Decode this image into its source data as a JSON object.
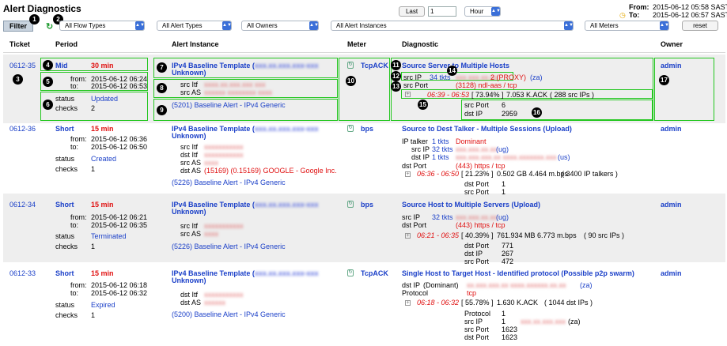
{
  "app": {
    "title": "Alert Diagnostics",
    "filter_tab": "Filter",
    "refresh_icon": "refresh-icon"
  },
  "time_range": {
    "last_label": "Last",
    "count": "1",
    "unit": "Hour",
    "from_label": "From:",
    "from_value": "2015-06-12 05:58 SAST",
    "to_label": "To:",
    "to_value": "2015-06-12 06:57 SAST"
  },
  "filters": {
    "flow_types": "All Flow Types",
    "alert_types": "All Alert Types",
    "owners": "All Owners",
    "instances": "All Alert Instances",
    "meters": "All Meters",
    "reset": "reset"
  },
  "columns": {
    "ticket": "Ticket",
    "period": "Period",
    "instance": "Alert Instance",
    "meter": "Meter",
    "diagnostic": "Diagnostic",
    "owner": "Owner"
  },
  "badges": [
    "1",
    "2",
    "3",
    "4",
    "5",
    "6",
    "7",
    "8",
    "9",
    "10",
    "11",
    "12",
    "13",
    "14",
    "15",
    "16",
    "17"
  ],
  "colors": {
    "highlight": "#22c61e",
    "link": "#1a3fc8",
    "alert": "#e01010",
    "row_alt": "#eeeeee"
  },
  "rows": [
    {
      "ticket": "0612-35",
      "severity": "Mid",
      "duration": "30 min",
      "from_label": "from:",
      "from": "2015-06-12 06:24",
      "to_label": "to:",
      "to": "2015-06-12 06:53",
      "status_label": "status",
      "status": "Updated",
      "checks_label": "checks",
      "checks": "2",
      "instance_title": "IPv4 Baseline Template (",
      "instance_blur": "xxx.xx.xxx.xxx-xxx",
      "instance_tail": "Unknown)",
      "instance_fields": [
        {
          "label": "src Itf",
          "value": "xxxx.xx.xxx.xxx xxx"
        },
        {
          "label": "src AS",
          "value": "xxxxxx xxxxxxxx xxxx"
        }
      ],
      "alert_link": "(5201)  Baseline Alert - IPv4 Generic",
      "meter": "TcpACK",
      "diag_title": "Source Server to Multiple Hosts",
      "diag_lines": [
        {
          "label": "src IP",
          "tkts": "34 tkts",
          "blur": "xxx.xxx.xx.xx",
          "extra": "2 (PROXY)",
          "tag": "(za)"
        },
        {
          "label": "src Port",
          "extra": "(3128) ndl-aas / tcp"
        }
      ],
      "time_window": "06:39 - 06:53",
      "pct": "[ 73.94% ]",
      "rate": "7.053 K.ACK",
      "peers": "( 288 src IPs )",
      "details": [
        {
          "label": "src Port",
          "value": "6"
        },
        {
          "label": "dst IP",
          "value": "2959"
        }
      ],
      "owner": "admin"
    },
    {
      "ticket": "0612-36",
      "severity": "Short",
      "duration": "15 min",
      "from_label": "from:",
      "from": "2015-06-12 06:36",
      "to_label": "to:",
      "to": "2015-06-12 06:50",
      "status_label": "status",
      "status": "Created",
      "checks_label": "checks",
      "checks": "1",
      "instance_title": "IPv4 Baseline Template (",
      "instance_blur": "xxx.xx.xxx.xxx-xxx",
      "instance_tail": "Unknown)",
      "instance_fields": [
        {
          "label": "src Itf",
          "value": "xxxxxxxxxxx"
        },
        {
          "label": "dst Itf",
          "value": "xxxxxxxxxxx"
        },
        {
          "label": "src AS",
          "value": "xxxx"
        },
        {
          "label": "dst AS",
          "value": "(15169) (0.15169) GOOGLE - Google Inc."
        }
      ],
      "alert_link": "(5226)  Baseline Alert - IPv4 Generic",
      "meter": "bps",
      "diag_title": "Source to Dest Talker - Multiple Sessions (Upload)",
      "ip_talker_label": "IP talker",
      "ip_talker_tkts": "1 tkts",
      "ip_talker_tag": "Dominant",
      "src_ip_tkts": "32 tkts",
      "src_ip_tag": "(ug)",
      "dst_ip_tkts": "1 tkts",
      "dst_ip_tag": "(us)",
      "dst_port": "(443) https / tcp",
      "time_window": "06:36 - 06:50",
      "pct": "[ 21.23% ]",
      "rate": "0.502 GB   4.464 m.bps",
      "peers": "( 3400 IP talkers )",
      "details": [
        {
          "label": "dst Port",
          "value": "1"
        },
        {
          "label": "src Port",
          "value": "1"
        }
      ],
      "owner": "admin"
    },
    {
      "ticket": "0612-34",
      "severity": "Short",
      "duration": "15 min",
      "from_label": "from:",
      "from": "2015-06-12 06:21",
      "to_label": "to:",
      "to": "2015-06-12 06:35",
      "status_label": "status",
      "status": "Terminated",
      "checks_label": "checks",
      "checks": "1",
      "instance_title": "IPv4 Baseline Template (",
      "instance_blur": "xxx.xx.xxx.xxx-xxx",
      "instance_tail": "Unknown)",
      "instance_fields": [
        {
          "label": "src Itf",
          "value": "xxxxxxxxxxx"
        },
        {
          "label": "src AS",
          "value": "xxxx"
        }
      ],
      "alert_link": "(5226)  Baseline Alert - IPv4 Generic",
      "meter": "bps",
      "diag_title": "Source Host to Multiple Servers (Upload)",
      "src_ip_tkts": "32 tkts",
      "src_ip_tag": "(ug)",
      "dst_port": "(443) https / tcp",
      "time_window": "06:21 - 06:35",
      "pct": "[ 40.39% ]",
      "rate": "761.934 MB   6.773 m.bps",
      "peers": "( 90 src IPs )",
      "details": [
        {
          "label": "dst Port",
          "value": "771"
        },
        {
          "label": "dst IP",
          "value": "267"
        },
        {
          "label": "src Port",
          "value": "472"
        }
      ],
      "owner": "admin"
    },
    {
      "ticket": "0612-33",
      "severity": "Short",
      "duration": "15 min",
      "from_label": "from:",
      "from": "2015-06-12 06:18",
      "to_label": "to:",
      "to": "2015-06-12 06:32",
      "status_label": "status",
      "status": "Expired",
      "checks_label": "checks",
      "checks": "1",
      "instance_title": "IPv4 Baseline Template (",
      "instance_blur": "xxx.xx.xxx.xxx-xxx",
      "instance_tail": "Unknown)",
      "instance_fields": [
        {
          "label": "dst Itf",
          "value": "xxxxxxxxxxx"
        },
        {
          "label": "dst AS",
          "value": "xxxxxx"
        }
      ],
      "alert_link": "(5200)  Baseline Alert - IPv4 Generic",
      "meter": "TcpACK",
      "diag_title": "Single Host to Target Host - Identified protocol (Possible p2p swarm)",
      "dst_ip_label": "dst IP",
      "dst_ip_prefix": "(Dominant)",
      "dst_ip_tag": "(za)",
      "protocol_label": "Protocol",
      "protocol": "tcp",
      "time_window": "06:18 - 06:32",
      "pct": "[ 55.78% ]",
      "rate": "1.630 K.ACK",
      "peers": "( 1044 dst IPs )",
      "details": [
        {
          "label": "Protocol",
          "value": "1"
        },
        {
          "label": "src IP",
          "value": "1"
        },
        {
          "label": "src Port",
          "value": "1623"
        },
        {
          "label": "dst Port",
          "value": "1623"
        }
      ],
      "src_ip_tag": "(za)",
      "owner": "admin"
    }
  ]
}
